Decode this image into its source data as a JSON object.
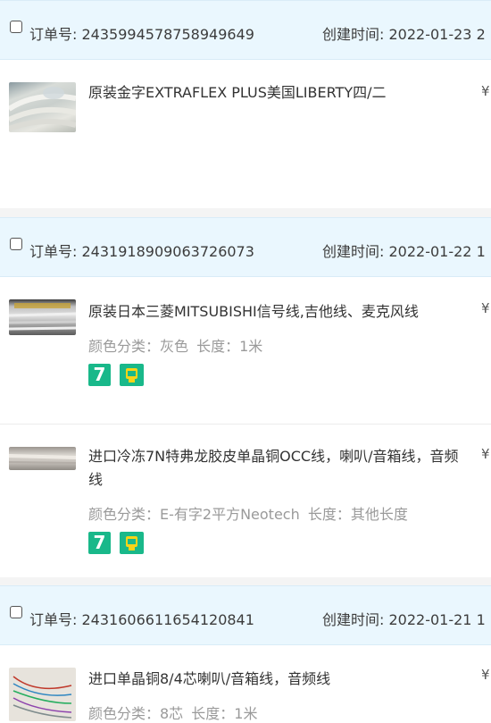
{
  "orders": [
    {
      "order_label": "订单号:",
      "order_no": "2435994578758949649",
      "created_label": "创建时间:",
      "created_at": "2022-01-23 2",
      "items": [
        {
          "title": "原装金字EXTRAFLEX PLUS美国LIBERTY四/二",
          "price": "¥",
          "attrs": []
        }
      ]
    },
    {
      "order_label": "订单号:",
      "order_no": "2431918909063726073",
      "created_label": "创建时间:",
      "created_at": "2022-01-22 1",
      "items": [
        {
          "title": "原装日本三菱MITSUBISHI信号线,吉他线、麦克风线",
          "price": "¥",
          "attrs": [
            "颜色分类：灰色",
            "长度：1米"
          ]
        },
        {
          "title": "进口冷冻7N特弗龙胶皮单晶铜OCC线，喇叭/音箱线，音频线",
          "price": "¥",
          "attrs": [
            "颜色分类：E-有字2平方Neotech",
            "长度：其他长度"
          ]
        }
      ]
    },
    {
      "order_label": "订单号:",
      "order_no": "2431606611654120841",
      "created_label": "创建时间:",
      "created_at": "2022-01-21 1",
      "items": [
        {
          "title": "进口单晶铜8/4芯喇叭/音箱线，音频线",
          "price": "¥",
          "attrs": [
            "颜色分类：8芯",
            "长度：1米"
          ]
        }
      ]
    }
  ],
  "badges": {
    "seven_day": "7",
    "seven_day_icon": "seven-day-return-badge",
    "guarantee_icon": "guarantee-shield-badge"
  },
  "colors": {
    "header_bg": "#eaf7fe",
    "badge_green": "#19b88a",
    "attr_gray": "#9a9a9a"
  }
}
